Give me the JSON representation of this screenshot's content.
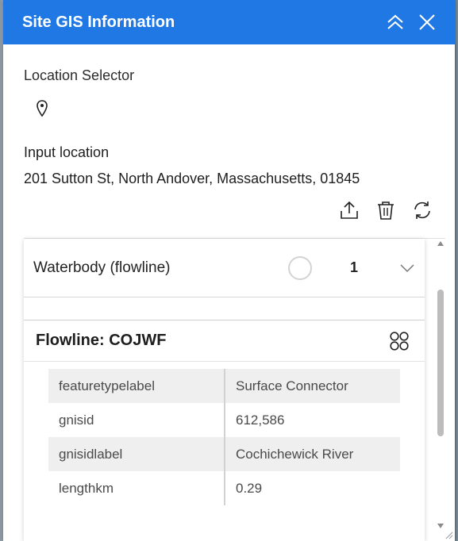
{
  "header": {
    "title": "Site GIS Information",
    "collapse_icon": "double-chevron-up-icon",
    "close_icon": "close-icon",
    "color": "#1f78e4"
  },
  "location_selector": {
    "label": "Location Selector",
    "pin_icon": "map-pin-icon"
  },
  "input_location": {
    "label": "Input location",
    "address": "201 Sutton St, North Andover, Massachusetts, 01845"
  },
  "toolbar": {
    "icons": [
      "export-icon",
      "trash-icon",
      "refresh-icon"
    ]
  },
  "layer": {
    "name": "Waterbody (flowline)",
    "count": "1",
    "expand_icon": "chevron-down-icon"
  },
  "feature": {
    "title": "Flowline: COJWF",
    "options_icon": "grid-circles-icon"
  },
  "attributes": [
    {
      "key": "featuretypelabel",
      "value": "Surface Connector"
    },
    {
      "key": "gnisid",
      "value": "612,586"
    },
    {
      "key": "gnisidlabel",
      "value": "Cochichewick River"
    },
    {
      "key": "lengthkm",
      "value": "0.29"
    }
  ]
}
